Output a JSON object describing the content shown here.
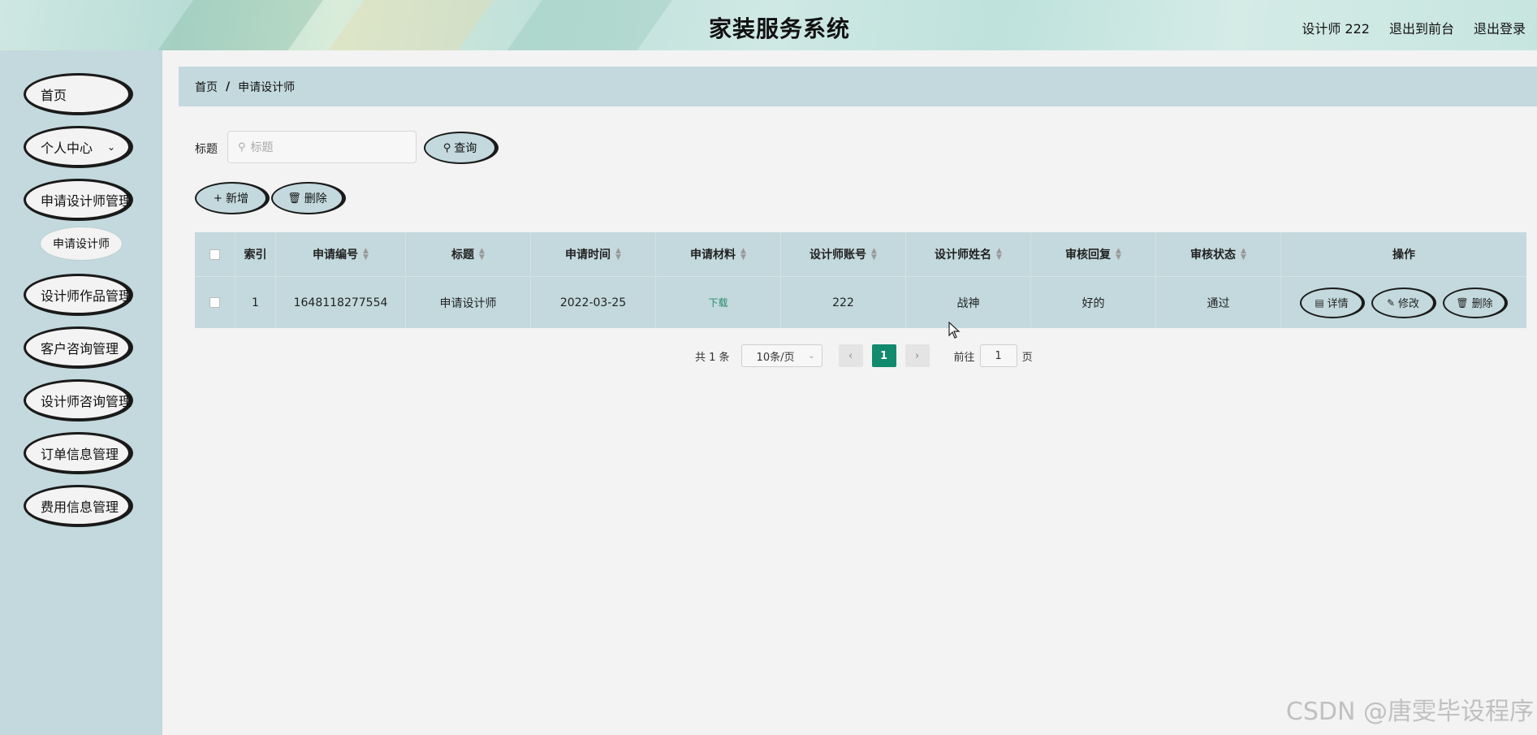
{
  "header": {
    "title": "家装服务系统",
    "user": "设计师 222",
    "to_front": "退出到前台",
    "logout": "退出登录"
  },
  "sidebar": {
    "items": [
      {
        "label": "首页"
      },
      {
        "label": "个人中心"
      },
      {
        "label": "申请设计师管理"
      },
      {
        "label": "设计师作品管理"
      },
      {
        "label": "客户咨询管理"
      },
      {
        "label": "设计师咨询管理"
      },
      {
        "label": "订单信息管理"
      },
      {
        "label": "费用信息管理"
      }
    ],
    "sub_item": "申请设计师"
  },
  "breadcrumb": {
    "home": "首页",
    "sep": "/",
    "current": "申请设计师"
  },
  "search": {
    "label": "标题",
    "placeholder": "标题",
    "query_button": "查询"
  },
  "toolbar": {
    "add_button": "新增",
    "delete_button": "删除"
  },
  "table": {
    "columns": [
      "索引",
      "申请编号",
      "标题",
      "申请时间",
      "申请材料",
      "设计师账号",
      "设计师姓名",
      "审核回复",
      "审核状态",
      "操作"
    ],
    "rows": [
      {
        "index": "1",
        "apply_no": "1648118277554",
        "title": "申请设计师",
        "apply_time": "2022-03-25",
        "material": "下载",
        "account": "222",
        "name": "战神",
        "reply": "好的",
        "status": "通过",
        "detail": "详情",
        "edit": "修改",
        "delete": "删除"
      }
    ]
  },
  "pager": {
    "total": "共 1 条",
    "page_size": "10条/页",
    "current_page": "1",
    "goto_label": "前往",
    "goto_value": "1",
    "page_unit": "页"
  },
  "watermark": "CSDN @唐雯毕设程序",
  "colors": {
    "accent": "#c3d9dd",
    "active_page": "#128a6e",
    "link": "#2a8a6a",
    "background": "#f3f3f3"
  }
}
